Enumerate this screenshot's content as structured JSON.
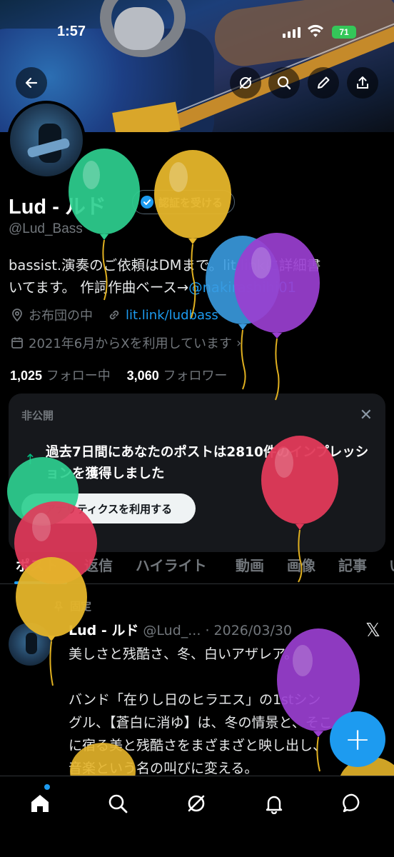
{
  "status": {
    "time": "1:57",
    "battery": "71"
  },
  "profile": {
    "name": "Lud - ルド",
    "verify_label": "認証を受ける",
    "handle": "@Lud_Bass",
    "bio_line1": "bassist.演奏のご依頼はDMまで。lit.linkに詳細書",
    "bio_line2_text": "いてます。 作詞作曲ベース→",
    "bio_line2_link": "@nakirashihi01",
    "location": "お布団の中",
    "website": "lit.link/ludbass",
    "joined": "2021年6月からXを利用しています",
    "following_count": "1,025",
    "following_label": "フォロー中",
    "followers_count": "3,060",
    "followers_label": "フォロワー"
  },
  "card": {
    "title": "非公開",
    "message": "過去7日間にあなたのポストは2810件のインプレッションを獲得しました",
    "cta": "アナリティクスを利用する"
  },
  "tabs": [
    "ポスト",
    "返信",
    "ハイライト",
    "動画",
    "画像",
    "記事",
    "い"
  ],
  "post": {
    "pinned_label": "固定",
    "author": "Lud - ルド",
    "handle": "@Lud_...",
    "date": "2026/03/30",
    "line1": "美しさと残酷さ、冬、白いアザレア。",
    "line2": "バンド「在りし日のヒラエス」の1stシン",
    "line3": "グル、【蒼白に消ゆ】は、冬の情景と、そこ",
    "line4": "に宿る美と残酷さをまざまざと映し出し、",
    "line5": "音楽という名の叫びに変える。"
  },
  "fab_label": "+",
  "balloon_colors": [
    "#2ecf8f",
    "#e5b52a",
    "#3a9be0",
    "#9a3fd0",
    "#e23a5a"
  ]
}
